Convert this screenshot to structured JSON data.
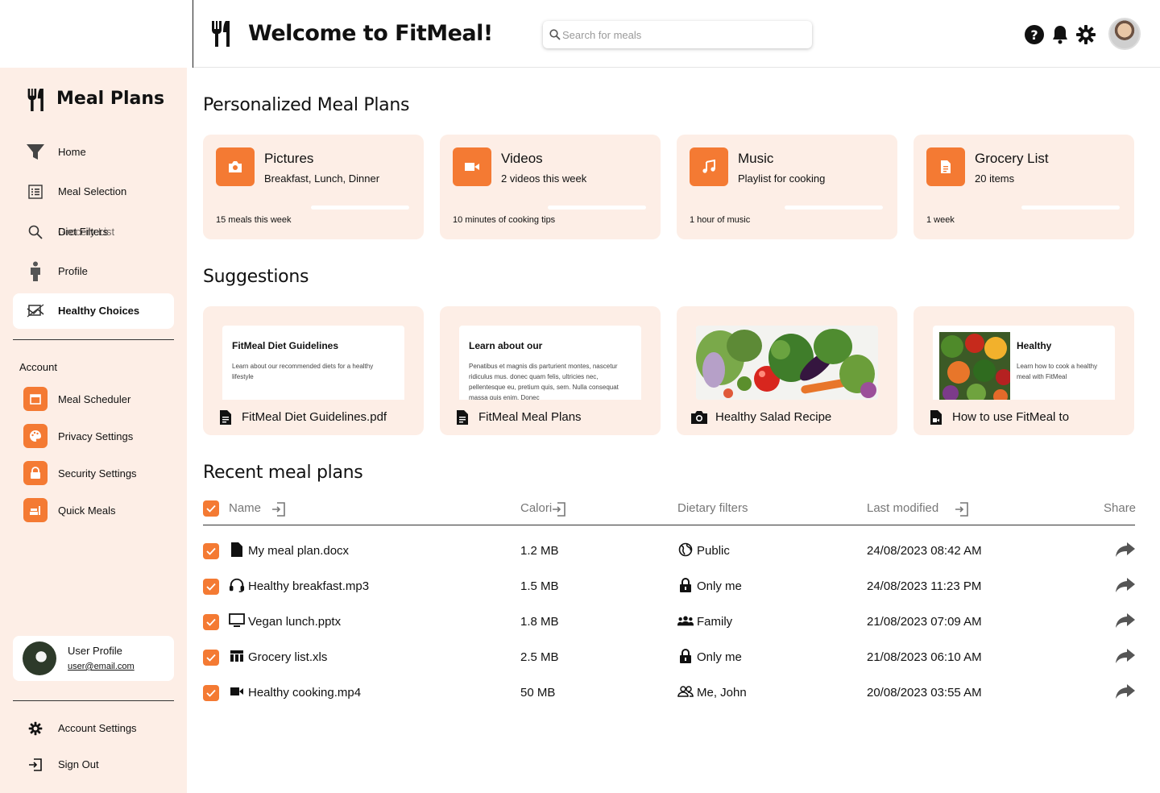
{
  "header": {
    "title": "Welcome to FitMeal!",
    "search_placeholder": "Search for meals"
  },
  "sidebar": {
    "title": "Meal Plans",
    "nav": [
      {
        "label": "Home",
        "icon": "funnel-icon"
      },
      {
        "label": "Meal Selection",
        "icon": "list-icon"
      },
      {
        "label": "Diet Filters",
        "icon": "search-icon",
        "overlay_label": "Grocery List"
      },
      {
        "label": "Profile",
        "icon": "person-icon"
      },
      {
        "label": "Healthy Choices",
        "icon": "compare-icon",
        "active": true
      }
    ],
    "account_label": "Account",
    "account": [
      {
        "label": "Meal Scheduler",
        "icon": "calendar-icon"
      },
      {
        "label": "Privacy Settings",
        "icon": "palette-icon"
      },
      {
        "label": "Security Settings",
        "icon": "lock-icon"
      },
      {
        "label": "Quick Meals",
        "icon": "food-icon"
      }
    ],
    "user": {
      "name": "User Profile",
      "email": "user@email.com"
    },
    "footer": [
      {
        "label": "Account Settings",
        "icon": "gear-icon"
      },
      {
        "label": "Sign Out",
        "icon": "sign-out-icon"
      }
    ]
  },
  "sections": {
    "personalized": "Personalized Meal Plans",
    "suggestions": "Suggestions",
    "recent": "Recent meal plans"
  },
  "cards": [
    {
      "title": "Pictures",
      "subtitle": "Breakfast, Lunch, Dinner",
      "footer": "15 meals this week",
      "progress": 0,
      "icon": "camera-icon"
    },
    {
      "title": "Videos",
      "subtitle": "2 videos this week",
      "footer": "10 minutes of cooking tips",
      "progress": 0,
      "icon": "video-icon"
    },
    {
      "title": "Music",
      "subtitle": "Playlist for cooking",
      "footer": "1 hour of music",
      "progress": 0,
      "icon": "music-icon"
    },
    {
      "title": "Grocery List",
      "subtitle": "20 items",
      "footer": "1 week",
      "progress": 0,
      "icon": "document-icon"
    }
  ],
  "suggestions": [
    {
      "preview_title": "FitMeal Diet Guidelines",
      "preview_text": "Learn about our recommended diets for a healthy lifestyle",
      "file": "FitMeal Diet Guidelines.pdf",
      "icon": "file-icon"
    },
    {
      "preview_title": "Learn about our",
      "preview_text": "Penatibus et magnis dis parturient montes, nascetur ridiculus mus. donec quam felis, ultricies nec, pellentesque eu, pretium quis, sem. Nulla consequat massa quis enim. Donec",
      "file": "FitMeal Meal Plans",
      "icon": "file-icon"
    },
    {
      "preview_title": "",
      "preview_text": "",
      "file": "Healthy Salad Recipe",
      "icon": "camera-icon"
    },
    {
      "preview_title": "Healthy",
      "preview_text": "Learn how to cook a healthy meal with FitMeal",
      "file": "How to use FitMeal to",
      "icon": "video-file-icon"
    }
  ],
  "table": {
    "headers": [
      "Name",
      "Calories",
      "Dietary filters",
      "Last modified",
      "Share"
    ],
    "header_name_visible": "Calori",
    "rows": [
      {
        "name": "My meal plan.docx",
        "icon": "file-icon",
        "size": "1.2 MB",
        "filter": "Public",
        "filter_icon": "globe-icon",
        "modified": "24/08/2023 08:42 AM"
      },
      {
        "name": "Healthy breakfast.mp3",
        "icon": "headset-icon",
        "size": "1.5 MB",
        "filter": "Only me",
        "filter_icon": "lock-icon",
        "modified": "24/08/2023 11:23 PM"
      },
      {
        "name": "Vegan lunch.pptx",
        "icon": "monitor-icon",
        "size": "1.8 MB",
        "filter": "Family",
        "filter_icon": "group-icon",
        "modified": "21/08/2023 07:09 AM"
      },
      {
        "name": "Grocery list.xls",
        "icon": "table-icon",
        "size": "2.5 MB",
        "filter": "Only me",
        "filter_icon": "lock-icon",
        "modified": "21/08/2023 06:10 AM"
      },
      {
        "name": "Healthy cooking.mp4",
        "icon": "video-icon",
        "size": "50 MB",
        "filter": "Me, John",
        "filter_icon": "people-icon",
        "modified": "20/08/2023 03:55 AM"
      }
    ]
  },
  "colors": {
    "accent": "#f47a33",
    "panel": "#fdeee6"
  }
}
